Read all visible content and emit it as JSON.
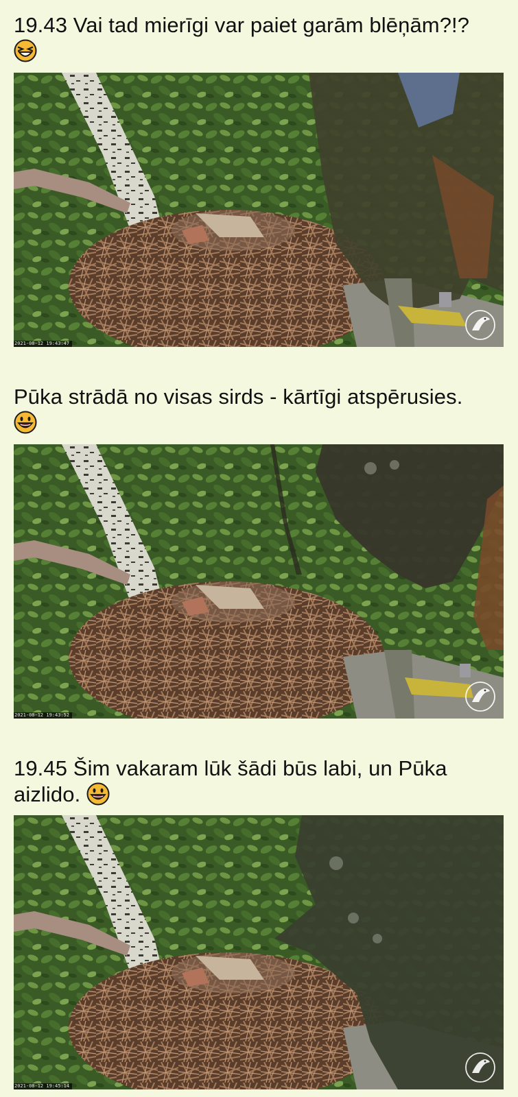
{
  "posts": [
    {
      "text": "19.43 Vai tad mierīgi var paiet garām blēņām?!?",
      "emoji": "grinning-squinting-face-icon",
      "timestamp": "2021-08-12 19:43:47",
      "scene": "nest-with-adult-owl-right-foot-on-branch"
    },
    {
      "text": "Pūka strādā no visas sirds - kārtīgi atspērusies.",
      "emoji": "grinning-face-icon",
      "timestamp": "2021-08-12 19:43:52",
      "scene": "nest-with-blurred-owl-close-to-camera"
    },
    {
      "text": "19.45 Šim vakaram lūk šādi būs labi, un Pūka aizlido.",
      "emoji": "grinning-face-icon",
      "timestamp": "2021-08-12 19:45:14",
      "scene": "nest-with-blurred-owl-taking-off"
    }
  ],
  "colors": {
    "background": "#f3f8df",
    "text": "#111111",
    "emoji_face": "#f6b934",
    "foliage": "#41612a",
    "nest": "#7b5a42"
  }
}
